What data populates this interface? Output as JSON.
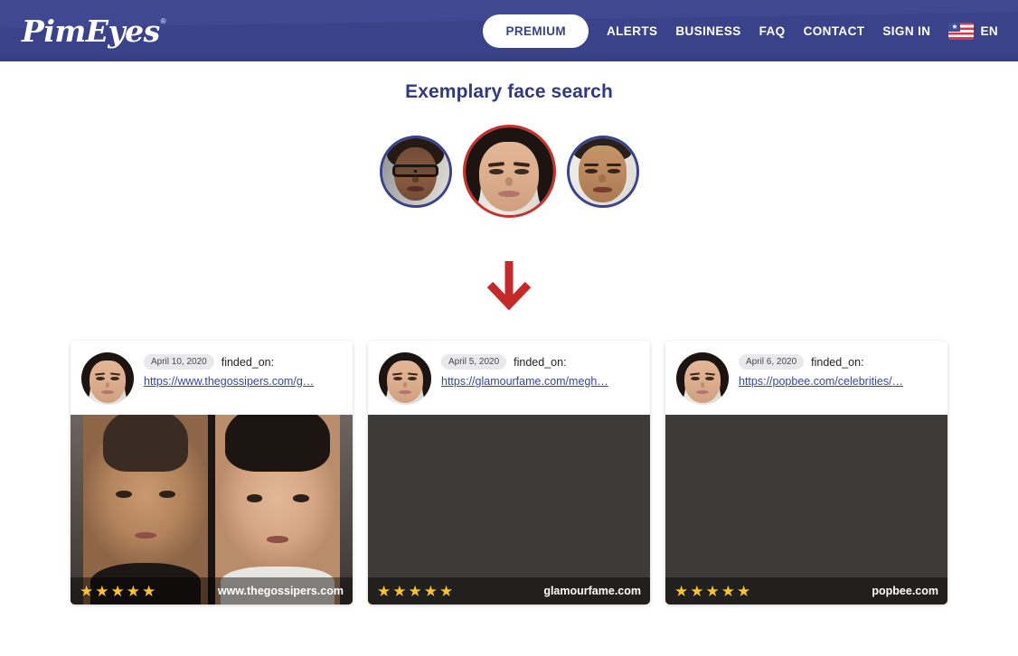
{
  "header": {
    "logo_text": "PimEyes",
    "logo_registered_mark": "®",
    "premium_label": "PREMIUM",
    "nav_links": [
      {
        "label": "ALERTS",
        "name": "nav-link-alerts"
      },
      {
        "label": "BUSINESS",
        "name": "nav-link-business"
      },
      {
        "label": "FAQ",
        "name": "nav-link-faq"
      },
      {
        "label": "CONTACT",
        "name": "nav-link-contact"
      },
      {
        "label": "SIGN IN",
        "name": "nav-link-sign-in"
      }
    ],
    "language": {
      "code": "EN",
      "flag": "us-flag-icon",
      "star_glyph": "★"
    },
    "background_color": "#3a4289"
  },
  "main": {
    "title": "Exemplary face search",
    "title_color": "#313a7d",
    "faces": [
      {
        "name": "face-avatar-1",
        "alt": "woman-with-glasses-face",
        "selected": false,
        "border_color": "#3a4289"
      },
      {
        "name": "face-avatar-2",
        "alt": "woman-face-selected",
        "selected": true,
        "border_color": "#c9302c"
      },
      {
        "name": "face-avatar-3",
        "alt": "man-face",
        "selected": false,
        "border_color": "#3a4289"
      }
    ],
    "arrow": {
      "icon": "arrow-down-icon",
      "color": "#c42a2a"
    },
    "finded_on_label": "finded_on:",
    "results": [
      {
        "date": "April 10, 2020",
        "label": "finded_on:",
        "url": "https://www.thegossipers.com/g…",
        "site": "www.thegossipers.com",
        "rating": 5,
        "star_glyph": "★"
      },
      {
        "date": "April 5, 2020",
        "label": "finded_on:",
        "url": "https://glamourfame.com/megh…",
        "site": "glamourfame.com",
        "rating": 5,
        "star_glyph": "★"
      },
      {
        "date": "April 6, 2020",
        "label": "finded_on:",
        "url": "https://popbee.com/celebrities/…",
        "site": "popbee.com",
        "rating": 5,
        "star_glyph": "★"
      }
    ]
  }
}
